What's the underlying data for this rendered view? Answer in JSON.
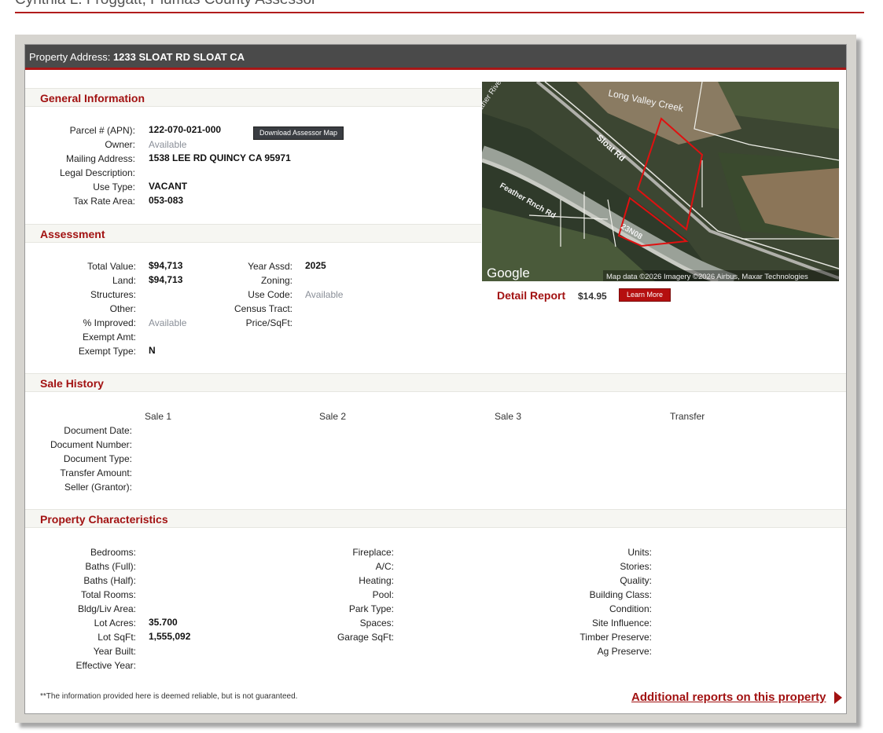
{
  "header": {
    "assessor": "Cynthia L. Froggatt, Plumas County Assessor"
  },
  "property": {
    "address_label": "Property Address:",
    "address": "1233 SLOAT RD SLOAT CA"
  },
  "general": {
    "title": "General Information",
    "download_button": "Download Assessor Map",
    "rows": [
      {
        "label": "Parcel # (APN):",
        "value": "122-070-021-000"
      },
      {
        "label": "Owner:",
        "value": "Available"
      },
      {
        "label": "Mailing Address:",
        "value": "1538 LEE RD QUINCY CA 95971"
      },
      {
        "label": "Legal Description:",
        "value": ""
      },
      {
        "label": "Use Type:",
        "value": "VACANT"
      },
      {
        "label": "Tax Rate Area:",
        "value": "053-083"
      }
    ]
  },
  "map": {
    "attribution": "Map data ©2026 Imagery ©2026 Airbus, Maxar Technologies",
    "logo": "Google",
    "labels": [
      "Long Valley Creek",
      "Sloat Rd",
      "Feather River",
      "Feather Rnch Rd",
      "23N08"
    ]
  },
  "detail_report": {
    "label": "Detail Report",
    "price": "$14.95",
    "button": "Learn More"
  },
  "assessment": {
    "title": "Assessment",
    "left": [
      {
        "label": "Total Value:",
        "value": "$94,713"
      },
      {
        "label": "Land:",
        "value": "$94,713"
      },
      {
        "label": "Structures:",
        "value": ""
      },
      {
        "label": "Other:",
        "value": ""
      },
      {
        "label": "% Improved:",
        "value": "Available"
      },
      {
        "label": "Exempt Amt:",
        "value": ""
      },
      {
        "label": "Exempt Type:",
        "value": "N"
      }
    ],
    "right": [
      {
        "label": "Year Assd:",
        "value": "2025"
      },
      {
        "label": "Zoning:",
        "value": ""
      },
      {
        "label": "Use Code:",
        "value": "Available"
      },
      {
        "label": "Census Tract:",
        "value": ""
      },
      {
        "label": "Price/SqFt:",
        "value": ""
      }
    ]
  },
  "sale_history": {
    "title": "Sale History",
    "columns": [
      "Sale 1",
      "Sale 2",
      "Sale 3",
      "Transfer"
    ],
    "rows": [
      "Document Date:",
      "Document Number:",
      "Document Type:",
      "Transfer Amount:",
      "Seller (Grantor):"
    ]
  },
  "characteristics": {
    "title": "Property Characteristics",
    "col1": [
      {
        "label": "Bedrooms:",
        "value": ""
      },
      {
        "label": "Baths (Full):",
        "value": ""
      },
      {
        "label": "Baths (Half):",
        "value": ""
      },
      {
        "label": "Total Rooms:",
        "value": ""
      },
      {
        "label": "Bldg/Liv Area:",
        "value": ""
      },
      {
        "label": "Lot Acres:",
        "value": "35.700"
      },
      {
        "label": "Lot SqFt:",
        "value": "1,555,092"
      },
      {
        "label": "Year Built:",
        "value": ""
      },
      {
        "label": "Effective Year:",
        "value": ""
      }
    ],
    "col2": [
      "Fireplace:",
      "A/C:",
      "Heating:",
      "Pool:",
      "Park Type:",
      "Spaces:",
      "Garage SqFt:"
    ],
    "col3": [
      "Units:",
      "Stories:",
      "Quality:",
      "Building Class:",
      "Condition:",
      "Site Influence:",
      "Timber Preserve:",
      "Ag Preserve:"
    ]
  },
  "footer": {
    "disclaimer": "**The information provided here is deemed reliable, but is not guaranteed.",
    "additional_link": "Additional reports on this property"
  }
}
